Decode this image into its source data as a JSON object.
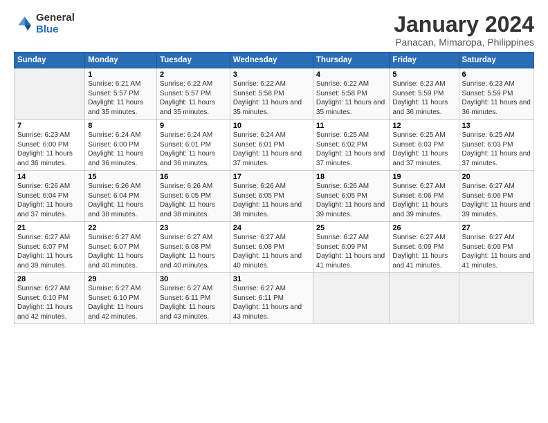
{
  "logo": {
    "general": "General",
    "blue": "Blue"
  },
  "title": "January 2024",
  "subtitle": "Panacan, Mimaropa, Philippines",
  "header_days": [
    "Sunday",
    "Monday",
    "Tuesday",
    "Wednesday",
    "Thursday",
    "Friday",
    "Saturday"
  ],
  "weeks": [
    [
      {
        "day": "",
        "detail": ""
      },
      {
        "day": "1",
        "detail": "Sunrise: 6:21 AM\nSunset: 5:57 PM\nDaylight: 11 hours\nand 35 minutes."
      },
      {
        "day": "2",
        "detail": "Sunrise: 6:22 AM\nSunset: 5:57 PM\nDaylight: 11 hours\nand 35 minutes."
      },
      {
        "day": "3",
        "detail": "Sunrise: 6:22 AM\nSunset: 5:58 PM\nDaylight: 11 hours\nand 35 minutes."
      },
      {
        "day": "4",
        "detail": "Sunrise: 6:22 AM\nSunset: 5:58 PM\nDaylight: 11 hours\nand 35 minutes."
      },
      {
        "day": "5",
        "detail": "Sunrise: 6:23 AM\nSunset: 5:59 PM\nDaylight: 11 hours\nand 36 minutes."
      },
      {
        "day": "6",
        "detail": "Sunrise: 6:23 AM\nSunset: 5:59 PM\nDaylight: 11 hours\nand 36 minutes."
      }
    ],
    [
      {
        "day": "7",
        "detail": "Sunrise: 6:23 AM\nSunset: 6:00 PM\nDaylight: 11 hours\nand 36 minutes."
      },
      {
        "day": "8",
        "detail": "Sunrise: 6:24 AM\nSunset: 6:00 PM\nDaylight: 11 hours\nand 36 minutes."
      },
      {
        "day": "9",
        "detail": "Sunrise: 6:24 AM\nSunset: 6:01 PM\nDaylight: 11 hours\nand 36 minutes."
      },
      {
        "day": "10",
        "detail": "Sunrise: 6:24 AM\nSunset: 6:01 PM\nDaylight: 11 hours\nand 37 minutes."
      },
      {
        "day": "11",
        "detail": "Sunrise: 6:25 AM\nSunset: 6:02 PM\nDaylight: 11 hours\nand 37 minutes."
      },
      {
        "day": "12",
        "detail": "Sunrise: 6:25 AM\nSunset: 6:03 PM\nDaylight: 11 hours\nand 37 minutes."
      },
      {
        "day": "13",
        "detail": "Sunrise: 6:25 AM\nSunset: 6:03 PM\nDaylight: 11 hours\nand 37 minutes."
      }
    ],
    [
      {
        "day": "14",
        "detail": "Sunrise: 6:26 AM\nSunset: 6:04 PM\nDaylight: 11 hours\nand 37 minutes."
      },
      {
        "day": "15",
        "detail": "Sunrise: 6:26 AM\nSunset: 6:04 PM\nDaylight: 11 hours\nand 38 minutes."
      },
      {
        "day": "16",
        "detail": "Sunrise: 6:26 AM\nSunset: 6:05 PM\nDaylight: 11 hours\nand 38 minutes."
      },
      {
        "day": "17",
        "detail": "Sunrise: 6:26 AM\nSunset: 6:05 PM\nDaylight: 11 hours\nand 38 minutes."
      },
      {
        "day": "18",
        "detail": "Sunrise: 6:26 AM\nSunset: 6:05 PM\nDaylight: 11 hours\nand 39 minutes."
      },
      {
        "day": "19",
        "detail": "Sunrise: 6:27 AM\nSunset: 6:06 PM\nDaylight: 11 hours\nand 39 minutes."
      },
      {
        "day": "20",
        "detail": "Sunrise: 6:27 AM\nSunset: 6:06 PM\nDaylight: 11 hours\nand 39 minutes."
      }
    ],
    [
      {
        "day": "21",
        "detail": "Sunrise: 6:27 AM\nSunset: 6:07 PM\nDaylight: 11 hours\nand 39 minutes."
      },
      {
        "day": "22",
        "detail": "Sunrise: 6:27 AM\nSunset: 6:07 PM\nDaylight: 11 hours\nand 40 minutes."
      },
      {
        "day": "23",
        "detail": "Sunrise: 6:27 AM\nSunset: 6:08 PM\nDaylight: 11 hours\nand 40 minutes."
      },
      {
        "day": "24",
        "detail": "Sunrise: 6:27 AM\nSunset: 6:08 PM\nDaylight: 11 hours\nand 40 minutes."
      },
      {
        "day": "25",
        "detail": "Sunrise: 6:27 AM\nSunset: 6:09 PM\nDaylight: 11 hours\nand 41 minutes."
      },
      {
        "day": "26",
        "detail": "Sunrise: 6:27 AM\nSunset: 6:09 PM\nDaylight: 11 hours\nand 41 minutes."
      },
      {
        "day": "27",
        "detail": "Sunrise: 6:27 AM\nSunset: 6:09 PM\nDaylight: 11 hours\nand 41 minutes."
      }
    ],
    [
      {
        "day": "28",
        "detail": "Sunrise: 6:27 AM\nSunset: 6:10 PM\nDaylight: 11 hours\nand 42 minutes."
      },
      {
        "day": "29",
        "detail": "Sunrise: 6:27 AM\nSunset: 6:10 PM\nDaylight: 11 hours\nand 42 minutes."
      },
      {
        "day": "30",
        "detail": "Sunrise: 6:27 AM\nSunset: 6:11 PM\nDaylight: 11 hours\nand 43 minutes."
      },
      {
        "day": "31",
        "detail": "Sunrise: 6:27 AM\nSunset: 6:11 PM\nDaylight: 11 hours\nand 43 minutes."
      },
      {
        "day": "",
        "detail": ""
      },
      {
        "day": "",
        "detail": ""
      },
      {
        "day": "",
        "detail": ""
      }
    ]
  ]
}
